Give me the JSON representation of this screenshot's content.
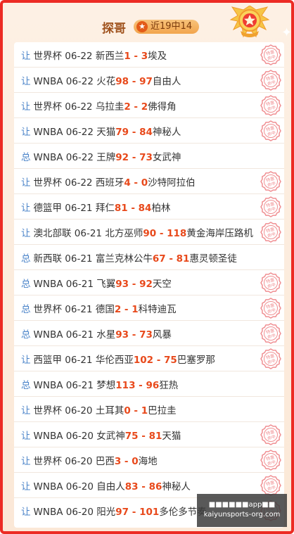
{
  "header": {
    "title": "探哥",
    "streak": "近19中14",
    "streak_icon": "star-icon"
  },
  "stamp_text_lines": [
    "特惠",
    "命中"
  ],
  "watermark": {
    "line1": "■■■■■■app■■",
    "line2": "kaiyunsports-org.com"
  },
  "colors": {
    "border": "#ec2b24",
    "score": "#e8491b",
    "type": "#4b84c9",
    "stamp": "#f08f92"
  },
  "matches": [
    {
      "type": "让",
      "league": "世界杯",
      "date": "06-22",
      "home": "新西兰",
      "hs": "1",
      "as": "3",
      "away": "埃及",
      "hit": true
    },
    {
      "type": "让",
      "league": "WNBA",
      "date": "06-22",
      "home": "火花",
      "hs": "98",
      "as": "97",
      "away": "自由人",
      "hit": true
    },
    {
      "type": "让",
      "league": "世界杯",
      "date": "06-22",
      "home": "乌拉圭",
      "hs": "2",
      "as": "2",
      "away": "佛得角",
      "hit": true
    },
    {
      "type": "让",
      "league": "WNBA",
      "date": "06-22",
      "home": "天猫",
      "hs": "79",
      "as": "84",
      "away": "神秘人",
      "hit": true
    },
    {
      "type": "总",
      "league": "WNBA",
      "date": "06-22",
      "home": "王牌",
      "hs": "92",
      "as": "73",
      "away": "女武神",
      "hit": false
    },
    {
      "type": "让",
      "league": "世界杯",
      "date": "06-22",
      "home": "西班牙",
      "hs": "4",
      "as": "0",
      "away": "沙特阿拉伯",
      "hit": true
    },
    {
      "type": "让",
      "league": "德篮甲",
      "date": "06-21",
      "home": "拜仁",
      "hs": "81",
      "as": "84",
      "away": "柏林",
      "hit": true
    },
    {
      "type": "让",
      "league": "澳北部联",
      "date": "06-21",
      "home": "北方巫师",
      "hs": "90",
      "as": "118",
      "away": "黄金海岸压路机",
      "hit": true
    },
    {
      "type": "总",
      "league": "新西联",
      "date": "06-21",
      "home": "富兰克林公牛",
      "hs": "67",
      "as": "81",
      "away": "惠灵顿圣徒",
      "hit": false
    },
    {
      "type": "总",
      "league": "WNBA",
      "date": "06-21",
      "home": "飞翼",
      "hs": "93",
      "as": "92",
      "away": "天空",
      "hit": true
    },
    {
      "type": "总",
      "league": "世界杯",
      "date": "06-21",
      "home": "德国",
      "hs": "2",
      "as": "1",
      "away": "科特迪瓦",
      "hit": true
    },
    {
      "type": "总",
      "league": "WNBA",
      "date": "06-21",
      "home": "水星",
      "hs": "93",
      "as": "73",
      "away": "风暴",
      "hit": true
    },
    {
      "type": "让",
      "league": "西篮甲",
      "date": "06-21",
      "home": "华伦西亚",
      "hs": "102",
      "as": "75",
      "away": "巴塞罗那",
      "hit": true
    },
    {
      "type": "总",
      "league": "WNBA",
      "date": "06-21",
      "home": "梦想",
      "hs": "113",
      "as": "96",
      "away": "狂热",
      "hit": false
    },
    {
      "type": "让",
      "league": "世界杯",
      "date": "06-20",
      "home": "土耳其",
      "hs": "0",
      "as": "1",
      "away": "巴拉圭",
      "hit": false
    },
    {
      "type": "让",
      "league": "WNBA",
      "date": "06-20",
      "home": "女武神",
      "hs": "75",
      "as": "81",
      "away": "天猫",
      "hit": true
    },
    {
      "type": "让",
      "league": "世界杯",
      "date": "06-20",
      "home": "巴西",
      "hs": "3",
      "as": "0",
      "away": "海地",
      "hit": true
    },
    {
      "type": "让",
      "league": "WNBA",
      "date": "06-20",
      "home": "自由人",
      "hs": "83",
      "as": "86",
      "away": "神秘人",
      "hit": true
    },
    {
      "type": "让",
      "league": "WNBA",
      "date": "06-20",
      "home": "阳光",
      "hs": "97",
      "as": "101",
      "away": "多伦多节奏",
      "hit": true
    }
  ]
}
